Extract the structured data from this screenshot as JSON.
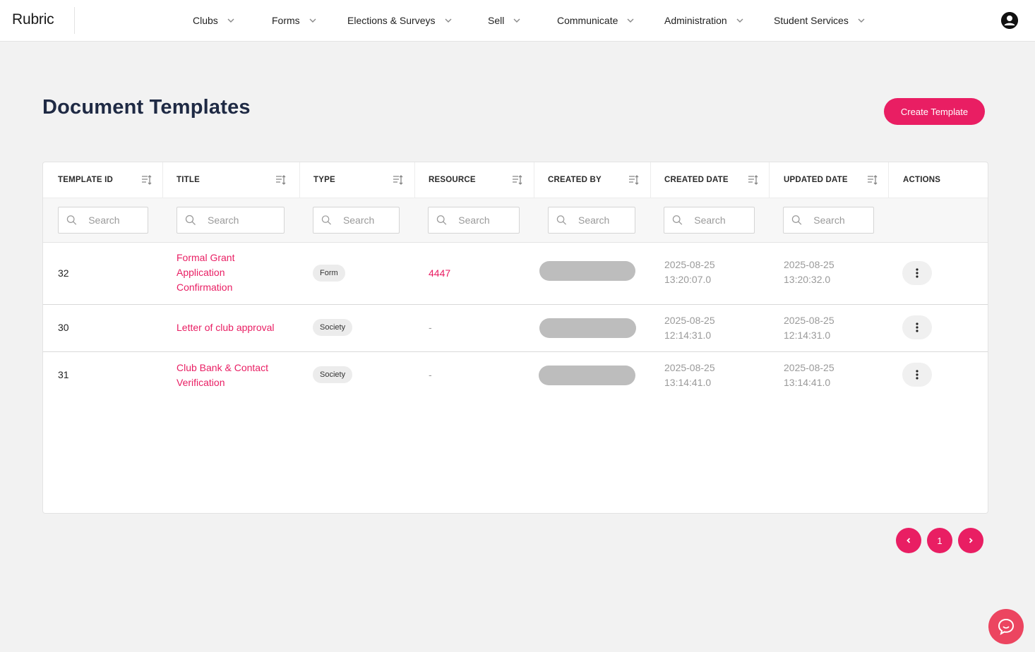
{
  "app": {
    "logo": "Rubric"
  },
  "nav": [
    {
      "label": "Clubs"
    },
    {
      "label": "Forms"
    },
    {
      "label": "Elections & Surveys"
    },
    {
      "label": "Sell"
    },
    {
      "label": "Communicate"
    },
    {
      "label": "Administration"
    },
    {
      "label": "Student Services"
    }
  ],
  "page": {
    "title": "Document Templates",
    "create_label": "Create Template"
  },
  "table": {
    "columns": [
      "TEMPLATE ID",
      "TITLE",
      "TYPE",
      "RESOURCE",
      "CREATED BY",
      "CREATED DATE",
      "UPDATED DATE",
      "ACTIONS"
    ],
    "search_placeholder": "Search",
    "rows": [
      {
        "id": "32",
        "title": [
          "Formal Grant",
          "Application",
          "Confirmation"
        ],
        "type": "Form",
        "resource": "4447",
        "created": [
          "2025-08-25",
          "13:20:07.0"
        ],
        "updated": [
          "2025-08-25",
          "13:20:32.0"
        ]
      },
      {
        "id": "30",
        "title": [
          "Letter of club approval"
        ],
        "type": "Society",
        "resource": "-",
        "created": [
          "2025-08-25",
          "12:14:31.0"
        ],
        "updated": [
          "2025-08-25",
          "12:14:31.0"
        ]
      },
      {
        "id": "31",
        "title": [
          "Club Bank & Contact",
          "Verification"
        ],
        "type": "Society",
        "resource": "-",
        "created": [
          "2025-08-25",
          "13:14:41.0"
        ],
        "updated": [
          "2025-08-25",
          "13:14:41.0"
        ]
      }
    ]
  },
  "pagination": {
    "current": "1"
  },
  "colors": {
    "accent": "#e91e63",
    "title": "#1f2a44",
    "chat": "#ec4560"
  },
  "icons": {
    "sort": "sort-icon",
    "search": "search-icon",
    "kebab": "kebab-menu-icon",
    "chat": "chat-icon",
    "user": "user-avatar-icon"
  }
}
